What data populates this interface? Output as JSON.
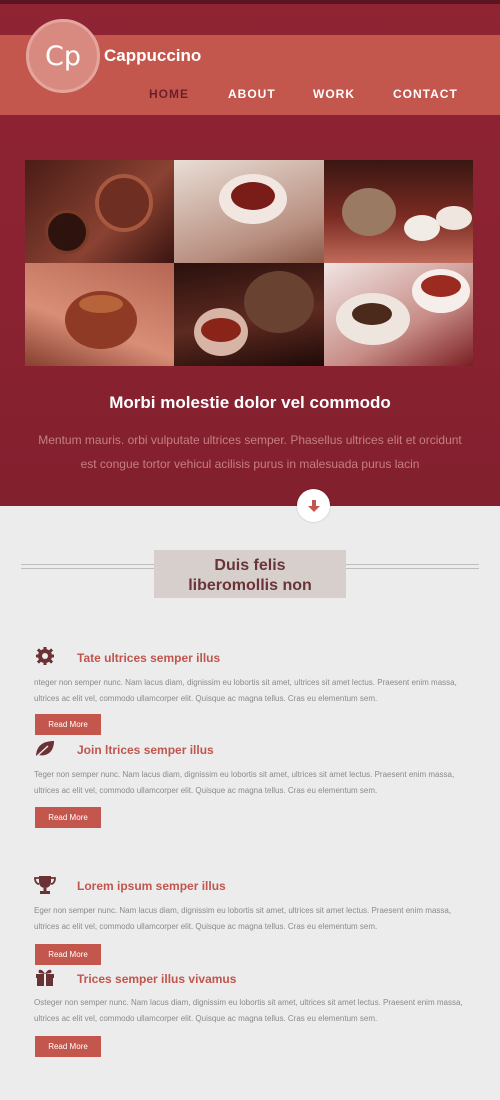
{
  "header": {
    "logo_text": "Cp",
    "brand": "Cappuccino",
    "nav": [
      "HOME",
      "ABOUT",
      "WORK",
      "CONTACT"
    ],
    "active_nav": "HOME"
  },
  "hero": {
    "title": "Morbi molestie dolor vel commodo",
    "text": "Mentum mauris. orbi vulputate ultrices semper. Phasellus ultrices elit et orcidunt est congue tortor vehicul acilisis purus in malesuada purus lacin"
  },
  "section": {
    "title_line1": "Duis felis",
    "title_line2": "liberomollis non"
  },
  "features": [
    {
      "icon": "gear-icon",
      "title": "Tate ultrices semper illus",
      "text": "nteger non semper nunc. Nam lacus diam, dignissim eu lobortis sit amet, ultrices sit amet lectus. Praesent enim massa, ultrices ac elit vel, commodo ullamcorper elit. Quisque ac magna tellus. Cras eu elementum sem.",
      "button": "Read More"
    },
    {
      "icon": "leaf-icon",
      "title": "Join ltrices semper illus",
      "text": "Teger non semper nunc. Nam lacus diam, dignissim eu lobortis sit amet, ultrices sit amet lectus. Praesent enim massa, ultrices ac elit vel, commodo ullamcorper elit. Quisque ac magna tellus. Cras eu elementum sem.",
      "button": "Read More"
    },
    {
      "icon": "trophy-icon",
      "title": "Lorem ipsum semper illus",
      "text": "Eger non semper nunc. Nam lacus diam, dignissim eu lobortis sit amet, ultrices sit amet lectus. Praesent enim massa, ultrices ac elit vel, commodo ullamcorper elit. Quisque ac magna tellus. Cras eu elementum sem.",
      "button": "Read More"
    },
    {
      "icon": "gift-icon",
      "title": "Trices semper illus vivamus",
      "text": "Osteger non semper nunc. Nam lacus diam, dignissim eu lobortis sit amet, ultrices sit amet lectus. Praesent enim massa, ultrices ac elit vel, commodo ullamcorper elit. Quisque ac magna tellus. Cras eu elementum sem.",
      "button": "Read More"
    }
  ],
  "colors": {
    "maroon": "#8a2231",
    "accent": "#c4574d",
    "heading": "#6a3438"
  }
}
